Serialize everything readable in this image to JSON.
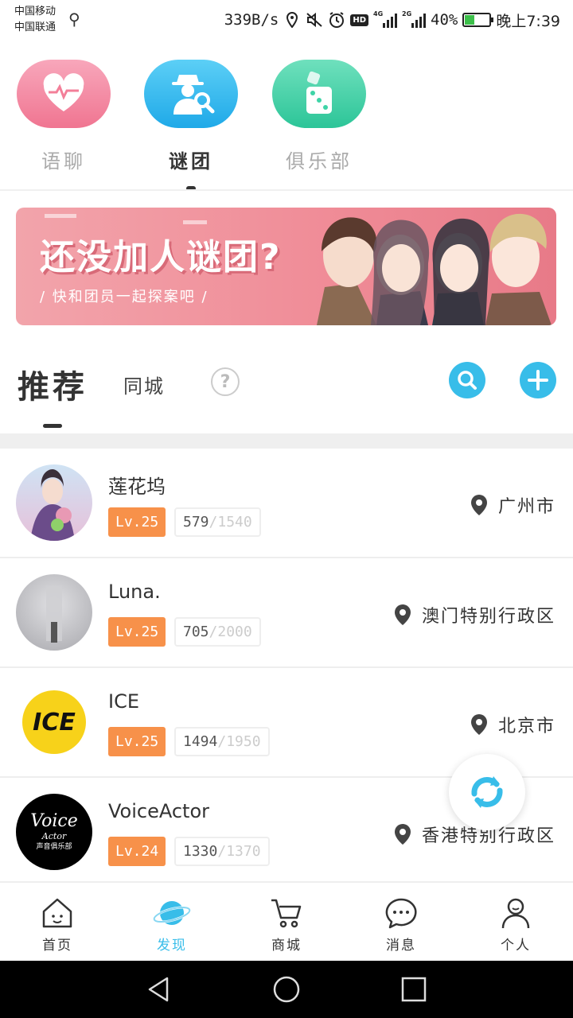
{
  "status_bar": {
    "carrier1": "中国移动",
    "carrier2": "中国联通",
    "speed": "339B/s",
    "net1": "4G",
    "net2": "2G",
    "battery": "40%",
    "battery_level": 0.4,
    "time": "晚上7:39"
  },
  "categories": [
    {
      "label": "语聊",
      "icon": "heart-pulse-icon",
      "color": "#f37f99"
    },
    {
      "label": "谜团",
      "icon": "detective-icon",
      "color": "#2fb8ef"
    },
    {
      "label": "俱乐部",
      "icon": "dice-icon",
      "color": "#3fd4a7"
    }
  ],
  "banner": {
    "title": "还没加人谜团?",
    "subtitle": "/ 快和团员一起探案吧 /"
  },
  "section_tabs": {
    "recommend": "推荐",
    "same_city": "同城",
    "help": "?"
  },
  "rooms": [
    {
      "name": "莲花坞",
      "level": "Lv.25",
      "exp_current": "579",
      "exp_total": "1540",
      "location": "广州市"
    },
    {
      "name": "Luna.",
      "level": "Lv.25",
      "exp_current": "705",
      "exp_total": "2000",
      "location": "澳门特别行政区"
    },
    {
      "name": "ICE",
      "level": "Lv.25",
      "exp_current": "1494",
      "exp_total": "1950",
      "location": "北京市"
    },
    {
      "name": "VoiceActor",
      "level": "Lv.24",
      "exp_current": "1330",
      "exp_total": "1370",
      "location": "香港特别行政区"
    }
  ],
  "avatars": {
    "ice_text": "ICE",
    "voice_text": "Voice",
    "actor_text": "Actor",
    "voice_club": "声音俱乐部"
  },
  "bottom_nav": [
    {
      "label": "首页",
      "icon": "home-icon"
    },
    {
      "label": "发现",
      "icon": "planet-icon"
    },
    {
      "label": "商城",
      "icon": "cart-icon"
    },
    {
      "label": "消息",
      "icon": "chat-icon"
    },
    {
      "label": "个人",
      "icon": "person-icon"
    }
  ],
  "colors": {
    "accent": "#38bde9",
    "level_badge": "#f7914a",
    "banner": "#f08d98"
  }
}
